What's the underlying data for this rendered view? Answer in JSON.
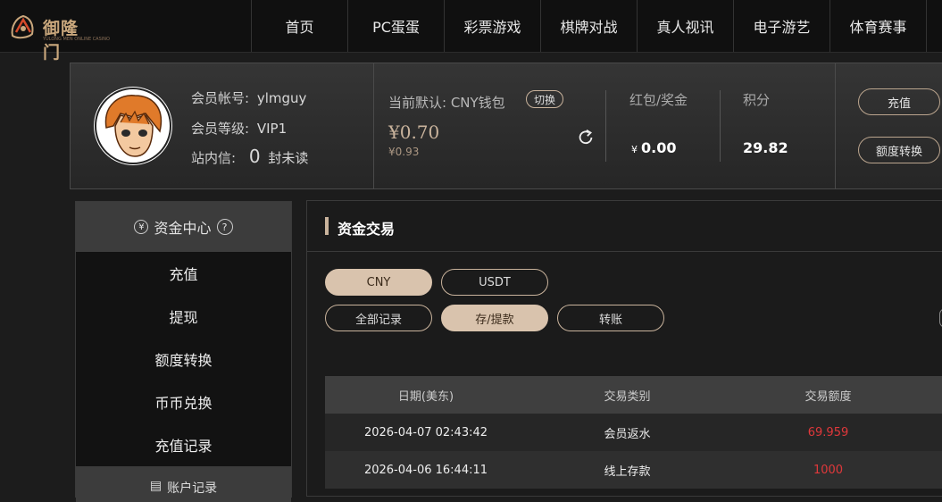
{
  "logo": {
    "brand": "御隆门",
    "tagline": "YULONG MEN ONLINE CASINO"
  },
  "nav": [
    "首页",
    "PC蛋蛋",
    "彩票游戏",
    "棋牌对战",
    "真人视讯",
    "电子游艺",
    "体育赛事"
  ],
  "member": {
    "account_label": "会员帐号:",
    "account_value": "ylmguy",
    "level_label": "会员等级:",
    "level_value": "VIP1",
    "msg_label": "站内信:",
    "msg_count": "0",
    "msg_suffix": "封未读"
  },
  "wallet": {
    "label": "当前默认: CNY钱包",
    "switch": "切换",
    "balance": "¥0.70",
    "sub_balance": "¥0.93"
  },
  "stats": {
    "bonus_label": "红包/奖金",
    "bonus_currency": "¥",
    "bonus_value": "0.00",
    "points_label": "积分",
    "points_value": "29.82"
  },
  "actions": {
    "deposit": "充值",
    "transfer": "额度转换"
  },
  "sidebar": {
    "header": "资金中心",
    "help": "?",
    "items": [
      "充值",
      "提现",
      "额度转换",
      "币币兑换",
      "充值记录"
    ],
    "footer": "账户记录"
  },
  "main": {
    "title": "资金交易",
    "currency_tabs": [
      "CNY",
      "USDT"
    ],
    "filter_tabs": [
      "全部记录",
      "存/提款",
      "转账"
    ],
    "table": {
      "headers": [
        "日期(美东)",
        "交易类别",
        "交易额度"
      ],
      "rows": [
        {
          "date": "2026-04-07 02:43:42",
          "type": "会员返水",
          "amount": "69.959"
        },
        {
          "date": "2026-04-06 16:44:11",
          "type": "线上存款",
          "amount": "1000"
        }
      ]
    }
  },
  "colors": {
    "accent": "#c9b39c",
    "active_bg": "#d9c3ad",
    "amount_red": "#e0383b"
  }
}
